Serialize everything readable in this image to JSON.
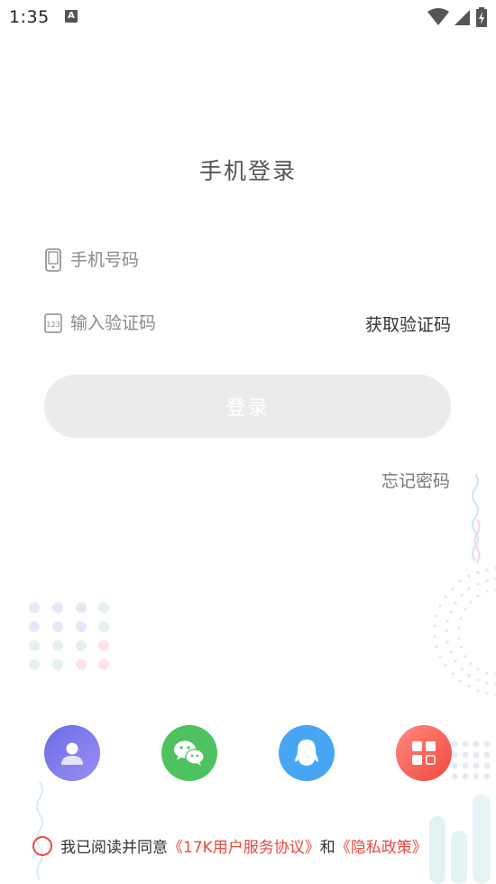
{
  "status_bar": {
    "time": "1:35",
    "a_badge": "A"
  },
  "title": "手机登录",
  "phone_field": {
    "placeholder": "手机号码",
    "value": "",
    "icon": "phone-icon"
  },
  "code_field": {
    "placeholder": "输入验证码",
    "value": "",
    "icon": "number-123-icon",
    "icon_text": "123",
    "get_code_label": "获取验证码"
  },
  "login_button": {
    "label": "登录"
  },
  "forgot_password": "忘记密码",
  "social_logins": [
    {
      "name": "account",
      "icon": "user-icon",
      "color": "#7b7deb"
    },
    {
      "name": "wechat",
      "icon": "wechat-icon",
      "color": "#4dc25f"
    },
    {
      "name": "qq",
      "icon": "qq-penguin-icon",
      "color": "#46a6f4"
    },
    {
      "name": "more",
      "icon": "grid-apps-icon",
      "color": "#f4574c"
    }
  ],
  "agreement": {
    "prefix": "我已阅读并同意",
    "user_agreement": "《17K用户服务协议》",
    "and": "和",
    "privacy_policy": "《隐私政策》"
  },
  "colors": {
    "accent": "#e8493d",
    "button_disabled": "#ebebeb"
  }
}
